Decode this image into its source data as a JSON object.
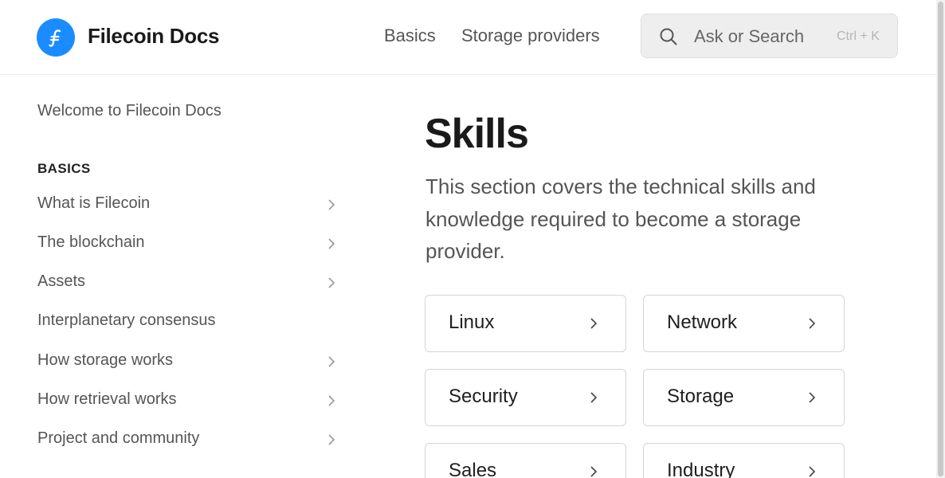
{
  "header": {
    "brand": "Filecoin Docs",
    "nav": [
      {
        "label": "Basics"
      },
      {
        "label": "Storage providers"
      }
    ],
    "search": {
      "placeholder": "Ask or Search",
      "shortcut": "Ctrl + K",
      "icon": "search-icon"
    },
    "logo_color": "#1a8cff"
  },
  "sidebar": {
    "welcome": "Welcome to Filecoin Docs",
    "section_title": "BASICS",
    "items": [
      {
        "label": "What is Filecoin",
        "expandable": true
      },
      {
        "label": "The blockchain",
        "expandable": true
      },
      {
        "label": "Assets",
        "expandable": true
      },
      {
        "label": "Interplanetary consensus",
        "expandable": false
      },
      {
        "label": "How storage works",
        "expandable": true
      },
      {
        "label": "How retrieval works",
        "expandable": true
      },
      {
        "label": "Project and community",
        "expandable": true
      }
    ]
  },
  "main": {
    "title": "Skills",
    "description": "This section covers the technical skills and knowledge required to become a storage provider.",
    "cards": [
      {
        "label": "Linux"
      },
      {
        "label": "Network"
      },
      {
        "label": "Security"
      },
      {
        "label": "Storage"
      },
      {
        "label": "Sales"
      },
      {
        "label": "Industry"
      }
    ]
  }
}
